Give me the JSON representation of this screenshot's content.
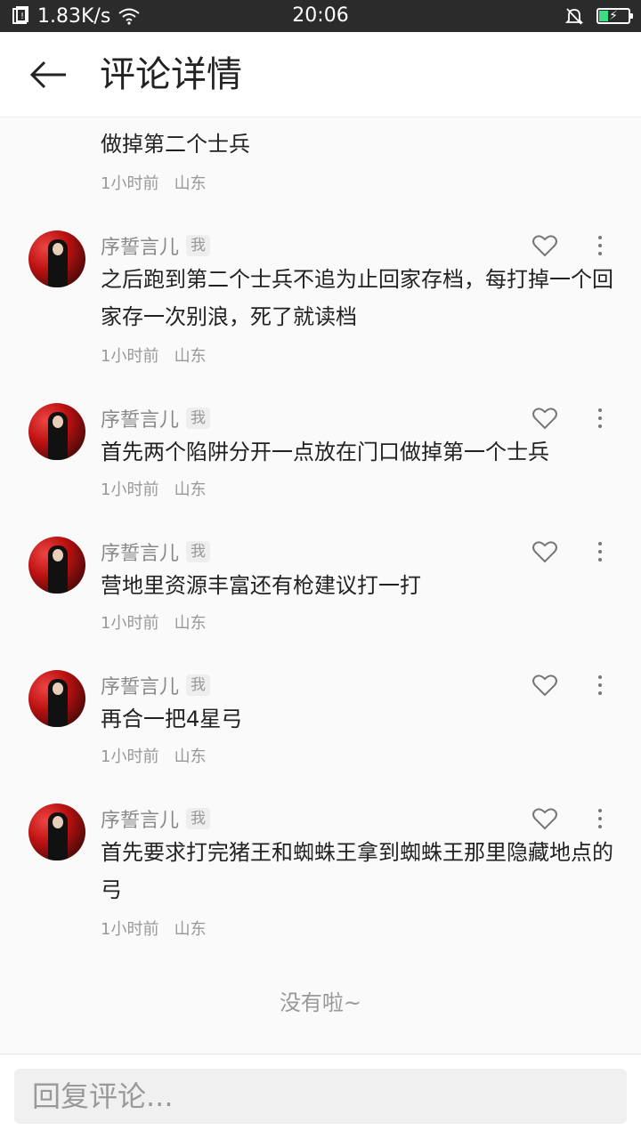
{
  "status_bar": {
    "net_speed": "1.83K/s",
    "time": "20:06",
    "icons": [
      "notification-icon",
      "wifi-icon",
      "mute-bell-icon",
      "battery-icon"
    ]
  },
  "header": {
    "title": "评论详情",
    "back_icon": "back-arrow-icon"
  },
  "partial_comment": {
    "text": "做掉第二个士兵",
    "time": "1小时前",
    "location": "山东"
  },
  "comments": [
    {
      "username": "序誓言儿",
      "badge": "我",
      "text": "之后跑到第二个士兵不追为止回家存档，每打掉一个回家存一次别浪，死了就读档",
      "time": "1小时前",
      "location": "山东"
    },
    {
      "username": "序誓言儿",
      "badge": "我",
      "text": "首先两个陷阱分开一点放在门口做掉第一个士兵",
      "time": "1小时前",
      "location": "山东"
    },
    {
      "username": "序誓言儿",
      "badge": "我",
      "text": "营地里资源丰富还有枪建议打一打",
      "time": "1小时前",
      "location": "山东"
    },
    {
      "username": "序誓言儿",
      "badge": "我",
      "text": "再合一把4星弓",
      "time": "1小时前",
      "location": "山东"
    },
    {
      "username": "序誓言儿",
      "badge": "我",
      "text": "首先要求打完猪王和蜘蛛王拿到蜘蛛王那里隐藏地点的弓",
      "time": "1小时前",
      "location": "山东"
    }
  ],
  "end_text": "没有啦~",
  "reply": {
    "placeholder": "回复评论..."
  }
}
